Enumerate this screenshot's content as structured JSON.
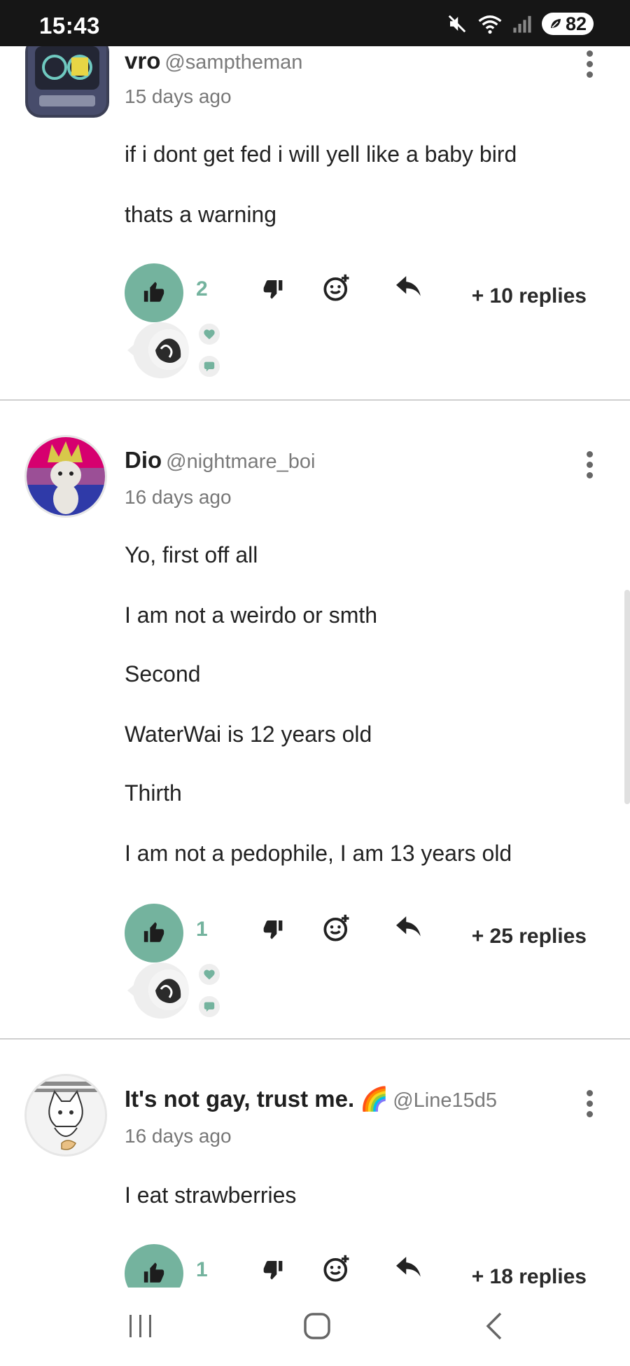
{
  "status_bar": {
    "time": "15:43",
    "battery": "82",
    "icons": [
      "mute-icon",
      "wifi-icon",
      "signal-icon",
      "battery-icon"
    ]
  },
  "comments": [
    {
      "display_name": "vro",
      "handle": "@samptheman",
      "time_ago": "15 days ago",
      "paragraphs": [
        "if i dont get fed i will yell like a baby bird",
        "thats a warning"
      ],
      "likes": "2",
      "replies": "+ 10 replies"
    },
    {
      "display_name": "Dio",
      "handle": "@nightmare_boi",
      "time_ago": "16 days ago",
      "paragraphs": [
        "Yo, first off all",
        "I am not a weirdo or smth",
        "Second",
        "WaterWai is 12 years old",
        "Thirth",
        "I am not a pedophile, I am 13 years old"
      ],
      "likes": "1",
      "replies": "+ 25 replies"
    },
    {
      "display_name": "It's not gay, trust me.",
      "display_emoji": "🌈",
      "handle": "@Line15d5",
      "time_ago": "16 days ago",
      "paragraphs": [
        "I eat strawberries"
      ],
      "likes": "1",
      "replies": "+ 18 replies"
    }
  ],
  "colors": {
    "accent": "#74b39e",
    "status_bar_bg": "#161616",
    "divider": "#cfcfcf"
  }
}
